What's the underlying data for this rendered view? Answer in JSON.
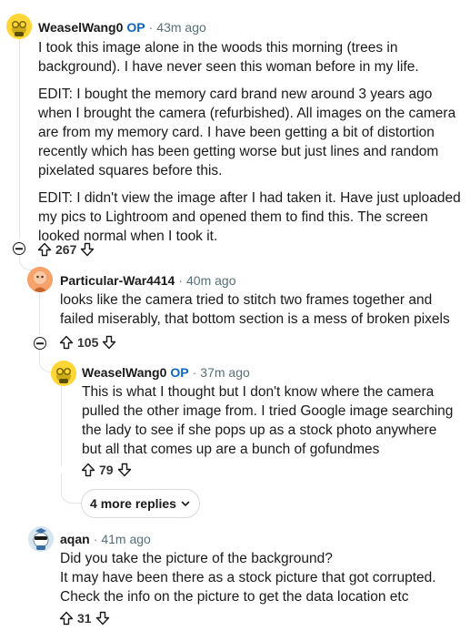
{
  "comments": [
    {
      "username": "WeaselWang0",
      "op_badge": "OP",
      "time": "43m ago",
      "paragraphs": [
        [
          "I took this image alone in the woods this morning (trees in",
          "background). I have never seen this woman before in my life."
        ],
        [
          "EDIT: I bought the memory card brand new around 3 years ago",
          "when I brought the camera (refurbished). All images on the camera",
          "are from my memory card. I have been getting a bit of distortion",
          "recently which has been getting worse but just lines and random",
          "pixelated squares before this."
        ],
        [
          "EDIT: I didn't view the image after I had taken it. Have just uploaded",
          "my pics to Lightroom and opened them to find this. The screen",
          "looked normal when I took it."
        ]
      ],
      "votes": "267"
    },
    {
      "username": "Particular-War4414",
      "time": "40m ago",
      "paragraphs": [
        [
          "looks like the camera tried to stitch two frames together and",
          "failed miserably, that bottom section is a mess of broken pixels"
        ]
      ],
      "votes": "105"
    },
    {
      "username": "WeaselWang0",
      "op_badge": "OP",
      "time": "37m ago",
      "paragraphs": [
        [
          "This is what I thought but I don't know where the camera",
          "pulled the other image from. I tried Google image searching",
          "the lady to see if she pops up as a stock photo anywhere",
          "but all that comes up are a bunch of gofundmes"
        ]
      ],
      "votes": "79"
    },
    {
      "username": "aqan",
      "time": "41m ago",
      "paragraphs": [
        [
          "Did you take the picture of the background?",
          "It may have been there as a stock picture that got corrupted.",
          "Check the info on the picture to get the data location etc"
        ]
      ],
      "votes": "31"
    }
  ],
  "more_replies_label": "4 more replies",
  "colors": {
    "op_badge": "#0a66c2",
    "thread_line": "#e2e6e9",
    "meta_gray": "#576f76"
  },
  "icons": [
    "upvote-icon",
    "downvote-icon",
    "collapse-icon",
    "chevron-down-icon"
  ]
}
